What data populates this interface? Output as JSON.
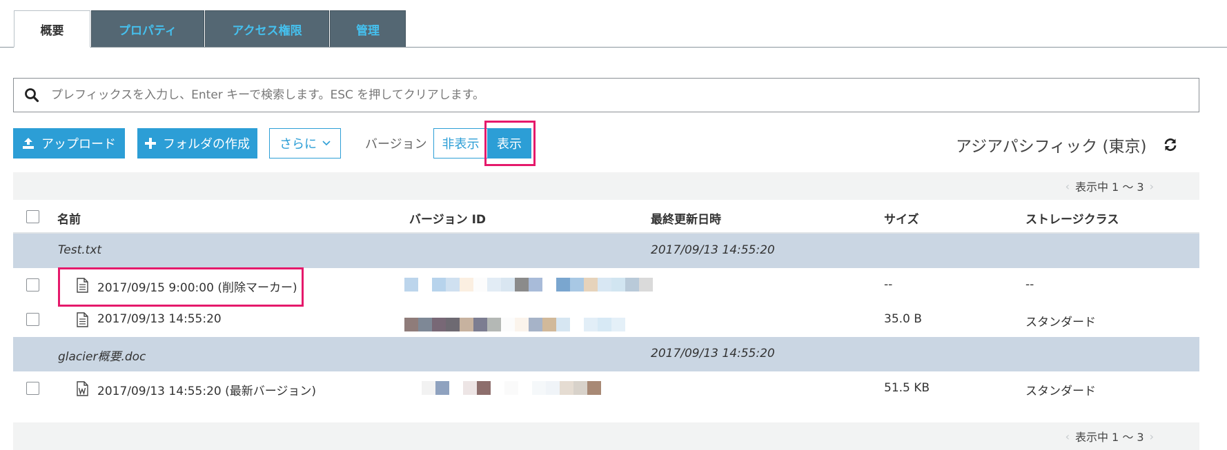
{
  "tabs": [
    {
      "label": "概要",
      "active": true
    },
    {
      "label": "プロパティ",
      "active": false
    },
    {
      "label": "アクセス権限",
      "active": false
    },
    {
      "label": "管理",
      "active": false
    }
  ],
  "search": {
    "placeholder": "プレフィックスを入力し、Enter キーで検索します。ESC を押してクリアします。",
    "value": ""
  },
  "toolbar": {
    "upload_label": "アップロード",
    "create_folder_label": "フォルダの作成",
    "more_label": "さらに",
    "version_label": "バージョン",
    "hide_label": "非表示",
    "show_label": "表示",
    "show_selected": true
  },
  "region": "アジアパシフィック (東京)",
  "pager": {
    "text": "表示中 1 ～ 3"
  },
  "columns": {
    "name": "名前",
    "version_id": "バージョン ID",
    "last_modified": "最終更新日時",
    "size": "サイズ",
    "storage_class": "ストレージクラス"
  },
  "groups": [
    {
      "name": "Test.txt",
      "last_modified": "2017/09/13 14:55:20",
      "versions": [
        {
          "name": "2017/09/15 9:00:00 (削除マーカー)",
          "icon": "text-file-icon",
          "size": "--",
          "storage_class": "--",
          "version_id_blocks": [
            "#bcd5ec",
            "#ffffff",
            "#b7d3ec",
            "#cfe0f0",
            "#fbefe1",
            "#fcfcfc",
            "#e2ecf5",
            "#d9e6f1",
            "#8b8b8b",
            "#a8bbd9",
            "#ffffff",
            "#7aa6cf",
            "#a8c8e4",
            "#e6d3bb",
            "#d8e7f3",
            "#d1e5f1",
            "#b9cad9",
            "#dadada"
          ]
        },
        {
          "name": "2017/09/13 14:55:20",
          "icon": "text-file-icon",
          "size": "35.0 B",
          "storage_class": "スタンダード",
          "version_id_blocks": [
            "#8f7c7a",
            "#7e8896",
            "#786876",
            "#6e6a72",
            "#c7b29f",
            "#7c7d91",
            "#b4b8b5",
            "#fcfcfc",
            "#fbf4ec",
            "#a6b3c8",
            "#d1b99a",
            "#d6e6f2",
            "#ffffff",
            "#e2eef7",
            "#d7e9f5",
            "#e4f0f8"
          ]
        }
      ]
    },
    {
      "name": "glacier概要.doc",
      "last_modified": "2017/09/13 14:55:20",
      "versions": [
        {
          "name": "2017/09/13 14:55:20 (最新バージョン)",
          "icon": "word-file-icon",
          "size": "51.5 KB",
          "storage_class": "スタンダード",
          "version_id_blocks": [
            "#ffffff",
            "#f2f2f2",
            "#8fa2bf",
            "#ffffff",
            "#ede5e5",
            "#8d6e6c",
            "#ffffff",
            "#fafafa",
            "#ffffff",
            "#f5f8fa",
            "#f0f4f8",
            "#e5dcd2",
            "#d8d2ca",
            "#a88975"
          ]
        }
      ]
    }
  ]
}
